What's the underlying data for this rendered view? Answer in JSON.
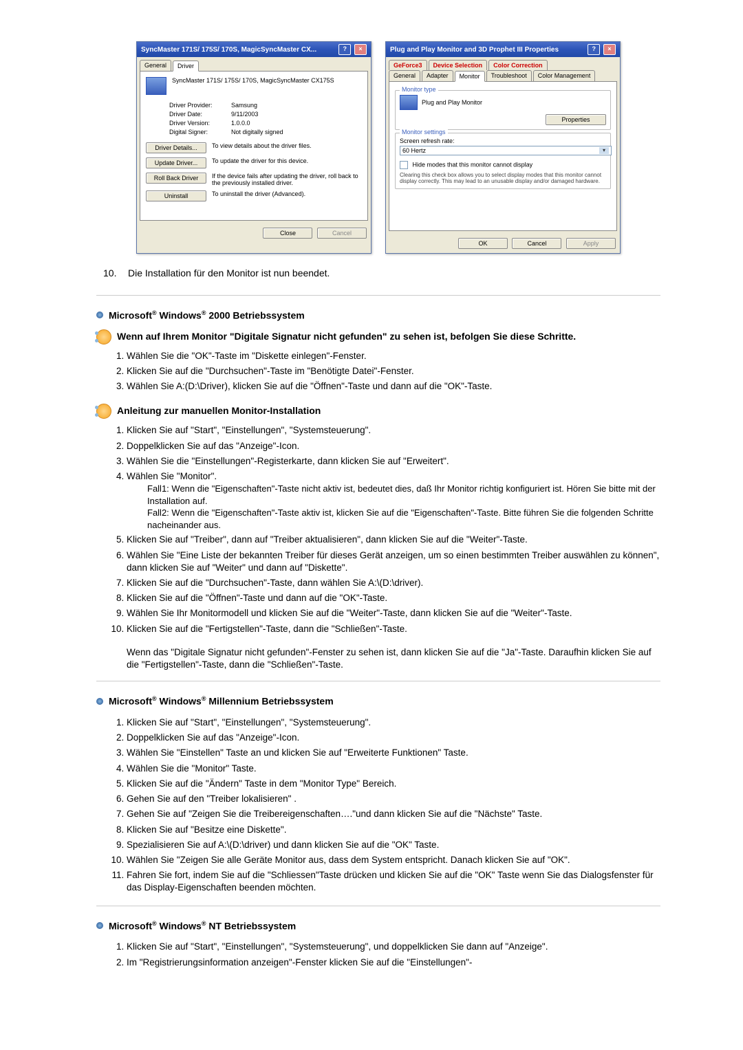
{
  "dialog1": {
    "title": "SyncMaster 171S/ 175S/ 170S, MagicSyncMaster CX...",
    "tab_general": "General",
    "tab_driver": "Driver",
    "device_name": "SyncMaster 171S/ 175S/ 170S, MagicSyncMaster CX175S",
    "provider_label": "Driver Provider:",
    "provider_value": "Samsung",
    "date_label": "Driver Date:",
    "date_value": "9/11/2003",
    "version_label": "Driver Version:",
    "version_value": "1.0.0.0",
    "signer_label": "Digital Signer:",
    "signer_value": "Not digitally signed",
    "btn_details": "Driver Details...",
    "btn_details_desc": "To view details about the driver files.",
    "btn_update": "Update Driver...",
    "btn_update_desc": "To update the driver for this device.",
    "btn_rollback": "Roll Back Driver",
    "btn_rollback_desc": "If the device fails after updating the driver, roll back to the previously installed driver.",
    "btn_uninstall": "Uninstall",
    "btn_uninstall_desc": "To uninstall the driver (Advanced).",
    "close": "Close",
    "cancel": "Cancel"
  },
  "dialog2": {
    "title": "Plug and Play Monitor and 3D Prophet III Properties",
    "tab_geforce": "GeForce3",
    "tab_devsel": "Device Selection",
    "tab_colorcorr": "Color Correction",
    "tab_general": "General",
    "tab_adapter": "Adapter",
    "tab_monitor": "Monitor",
    "tab_troubleshoot": "Troubleshoot",
    "tab_colormgmt": "Color Management",
    "grp_montype": "Monitor type",
    "montype_name": "Plug and Play Monitor",
    "btn_properties": "Properties",
    "grp_monset": "Monitor settings",
    "lbl_refresh": "Screen refresh rate:",
    "refresh_value": "60 Hertz",
    "chk_hide": "Hide modes that this monitor cannot display",
    "hide_desc": "Clearing this check box allows you to select display modes that this monitor cannot display correctly. This may lead to an unusable display and/or damaged hardware.",
    "ok": "OK",
    "cancel": "Cancel",
    "apply": "Apply"
  },
  "step10": {
    "num": "10.",
    "text": "Die Installation für den Monitor ist nun beendet."
  },
  "sec2000": {
    "title_prefix": "Microsoft",
    "title_middle": " Windows",
    "title_suffix": " 2000 Betriebssystem",
    "sub1_title": "Wenn auf Ihrem Monitor \"Digitale Signatur nicht gefunden\" zu sehen ist, befolgen Sie diese Schritte.",
    "sub1_steps": [
      "Wählen Sie die \"OK\"-Taste im \"Diskette einlegen\"-Fenster.",
      "Klicken Sie auf die \"Durchsuchen\"-Taste im \"Benötigte Datei\"-Fenster.",
      "Wählen Sie A:(D:\\Driver), klicken Sie auf die \"Öffnen\"-Taste und dann auf die \"OK\"-Taste."
    ],
    "sub2_title": "Anleitung zur manuellen Monitor-Installation",
    "sub2_s1": "Klicken Sie auf \"Start\", \"Einstellungen\", \"Systemsteuerung\".",
    "sub2_s2": "Doppelklicken Sie auf das \"Anzeige\"-Icon.",
    "sub2_s3": "Wählen Sie die \"Einstellungen\"-Registerkarte, dann klicken Sie auf \"Erweitert\".",
    "sub2_s4": "Wählen Sie \"Monitor\".",
    "fall1_label": "Fall1:",
    "fall1_text": "Wenn die \"Eigenschaften\"-Taste nicht aktiv ist, bedeutet dies, daß Ihr Monitor richtig konfiguriert ist. Hören Sie bitte mit der Installation auf.",
    "fall2_label": "Fall2:",
    "fall2_text": "Wenn die \"Eigenschaften\"-Taste aktiv ist, klicken Sie auf die \"Eigenschaften\"-Taste. Bitte führen Sie die folgenden Schritte nacheinander aus.",
    "sub2_s5": "Klicken Sie auf \"Treiber\", dann auf \"Treiber aktualisieren\", dann klicken Sie auf die \"Weiter\"-Taste.",
    "sub2_s6": "Wählen Sie \"Eine Liste der bekannten Treiber für dieses Gerät anzeigen, um so einen bestimmten Treiber auswählen zu können\", dann klicken Sie auf \"Weiter\" und dann auf \"Diskette\".",
    "sub2_s7": "Klicken Sie auf die \"Durchsuchen\"-Taste, dann wählen Sie A:\\(D:\\driver).",
    "sub2_s8": "Klicken Sie auf die \"Öffnen\"-Taste und dann auf die \"OK\"-Taste.",
    "sub2_s9": "Wählen Sie Ihr Monitormodell und klicken Sie auf die \"Weiter\"-Taste, dann klicken Sie auf die \"Weiter\"-Taste.",
    "sub2_s10": "Klicken Sie auf die \"Fertigstellen\"-Taste, dann die \"Schließen\"-Taste.",
    "after_note": "Wenn das \"Digitale Signatur nicht gefunden\"-Fenster zu sehen ist, dann klicken Sie auf die \"Ja\"-Taste. Daraufhin klicken Sie auf die \"Fertigstellen\"-Taste, dann die \"Schließen\"-Taste."
  },
  "secME": {
    "title_prefix": "Microsoft",
    "title_middle": " Windows",
    "title_suffix": " Millennium Betriebssystem",
    "steps": [
      "Klicken Sie auf \"Start\", \"Einstellungen\", \"Systemsteuerung\".",
      "Doppelklicken Sie auf das \"Anzeige\"-Icon.",
      "Wählen Sie \"Einstellen\" Taste an und klicken Sie auf \"Erweiterte Funktionen\" Taste.",
      "Wählen Sie die \"Monitor\" Taste.",
      "Klicken Sie auf die \"Ändern\" Taste in dem \"Monitor Type\" Bereich.",
      "Gehen Sie auf den \"Treiber lokalisieren\" .",
      "Gehen Sie auf \"Zeigen Sie die Treibereigenschaften….\"und dann klicken Sie auf die \"Nächste\" Taste.",
      "Klicken Sie auf \"Besitze eine Diskette\".",
      "Spezialisieren Sie auf A:\\(D:\\driver) und dann klicken Sie auf die \"OK\" Taste.",
      "Wählen Sie \"Zeigen Sie alle Geräte Monitor aus, dass dem System entspricht. Danach klicken Sie auf \"OK\".",
      "Fahren Sie fort, indem Sie auf die \"Schliessen\"Taste drücken und klicken Sie auf die \"OK\" Taste wenn Sie das Dialogsfenster für das Display-Eigenschaften beenden möchten."
    ]
  },
  "secNT": {
    "title_prefix": "Microsoft",
    "title_middle": " Windows",
    "title_suffix": " NT Betriebssystem",
    "steps": [
      "Klicken Sie auf \"Start\", \"Einstellungen\", \"Systemsteuerung\", und doppelklicken Sie dann auf \"Anzeige\".",
      "Im \"Registrierungsinformation anzeigen\"-Fenster klicken Sie auf die \"Einstellungen\"-"
    ]
  }
}
